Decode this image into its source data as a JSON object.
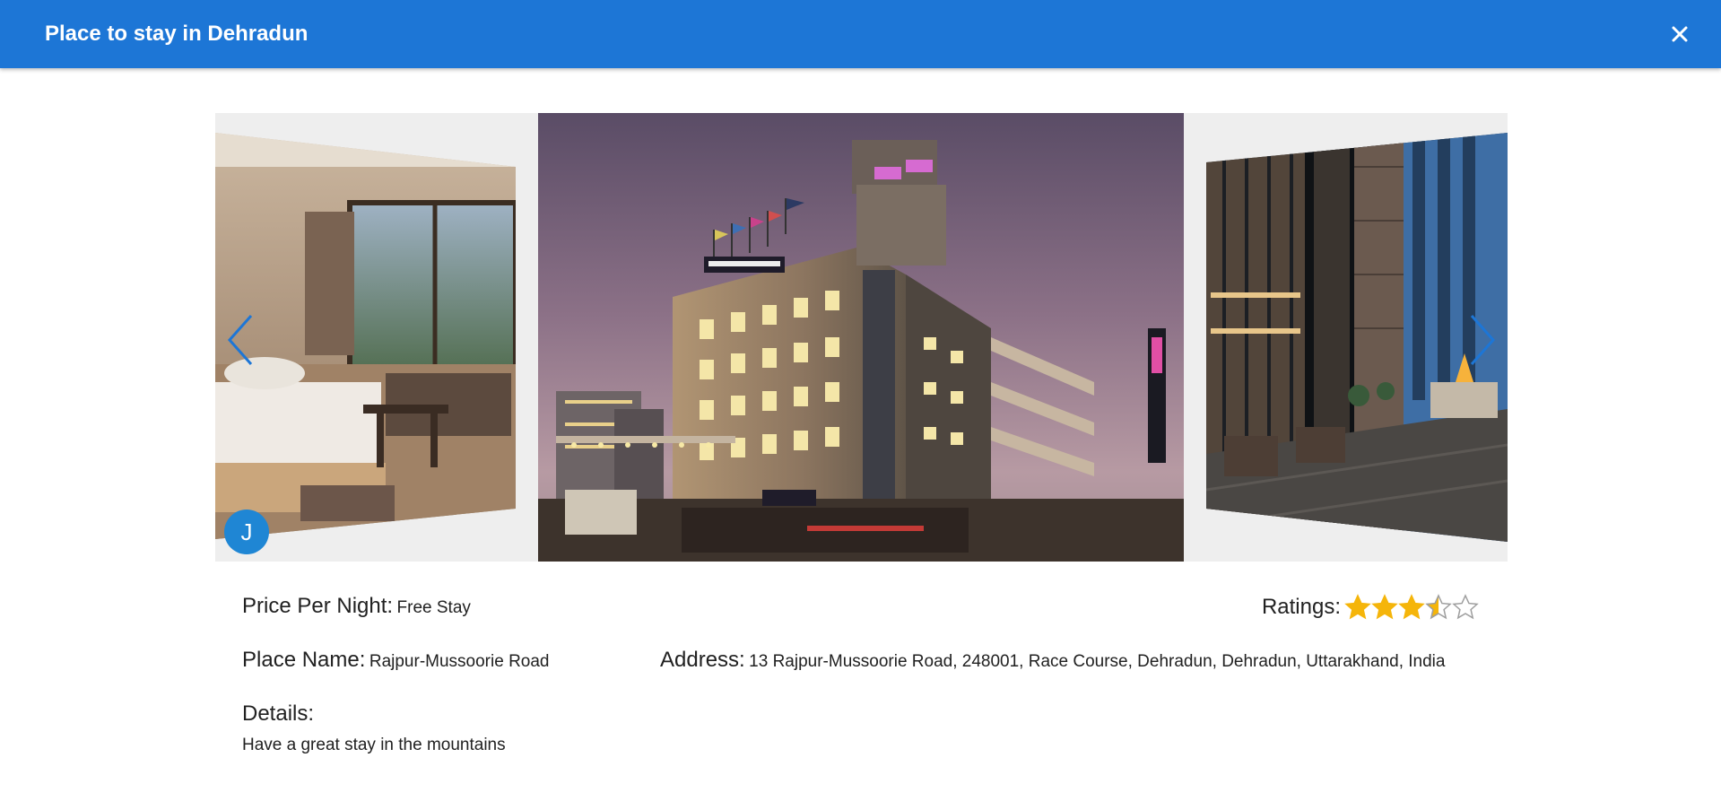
{
  "header": {
    "title": "Place to stay in Dehradun",
    "close_icon": "close-icon"
  },
  "carousel": {
    "prev_icon": "chevron-left-icon",
    "next_icon": "chevron-right-icon",
    "avatar_initial": "J",
    "slides": [
      "hotel-room-photo",
      "hotel-building-photo",
      "hotel-terrace-photo"
    ]
  },
  "details": {
    "price_label": "Price Per Night:",
    "price_value": "Free Stay",
    "ratings_label": "Ratings:",
    "rating": 3.5,
    "rating_max": 5,
    "place_name_label": "Place Name:",
    "place_name_value": "Rajpur-Mussoorie Road",
    "address_label": "Address:",
    "address_value": "13 Rajpur-Mussoorie Road, 248001, Race Course, Dehradun, Dehradun, Uttarakhand, India",
    "details_label": "Details:",
    "details_value": "Have a great stay in the mountains"
  },
  "colors": {
    "appbar": "#1d76d6",
    "star_filled": "#f5b50a",
    "star_empty": "#9e9e9e",
    "avatar": "#1f86d4",
    "arrow": "#1d76d6"
  }
}
